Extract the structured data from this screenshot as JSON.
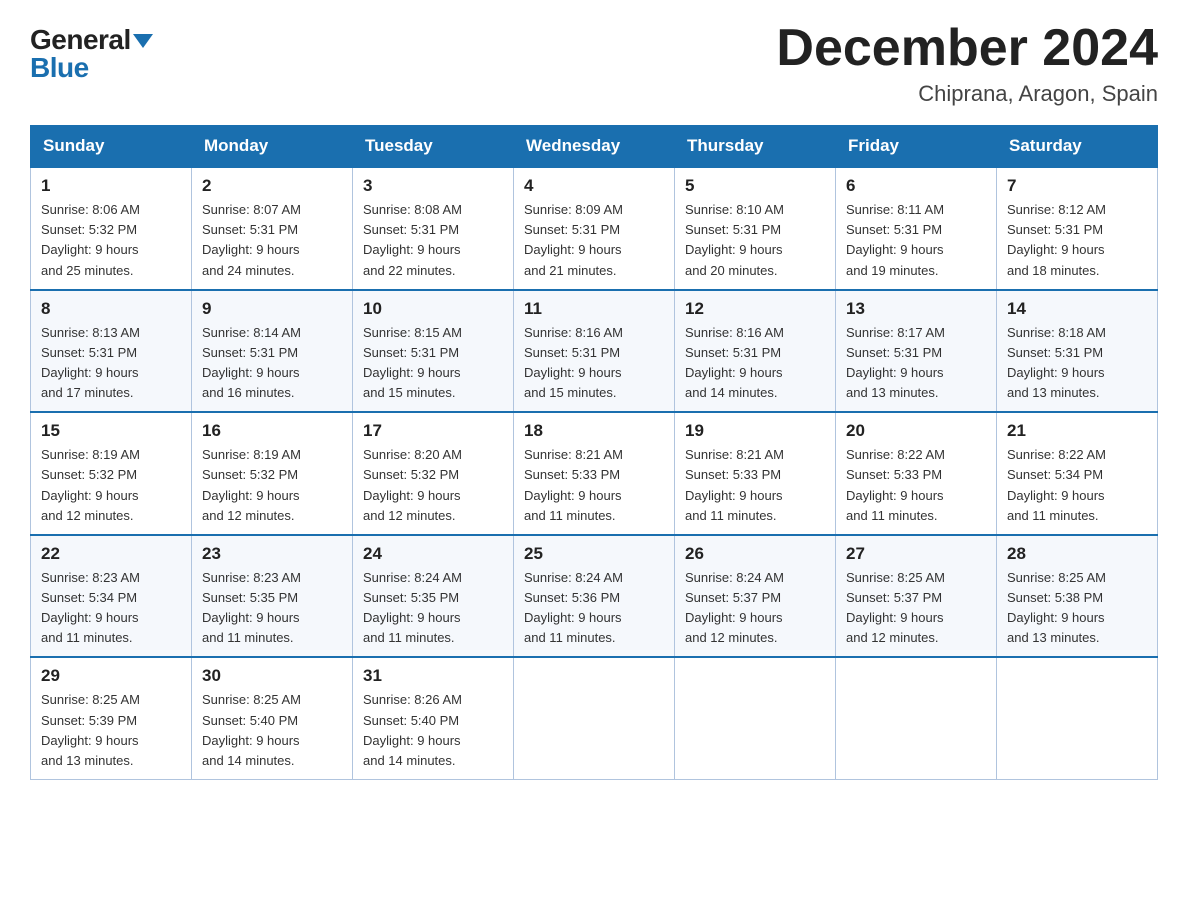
{
  "logo": {
    "general": "General",
    "blue": "Blue"
  },
  "header": {
    "month": "December 2024",
    "location": "Chiprana, Aragon, Spain"
  },
  "days_of_week": [
    "Sunday",
    "Monday",
    "Tuesday",
    "Wednesday",
    "Thursday",
    "Friday",
    "Saturday"
  ],
  "weeks": [
    [
      {
        "day": "1",
        "sunrise": "8:06 AM",
        "sunset": "5:32 PM",
        "daylight": "9 hours and 25 minutes."
      },
      {
        "day": "2",
        "sunrise": "8:07 AM",
        "sunset": "5:31 PM",
        "daylight": "9 hours and 24 minutes."
      },
      {
        "day": "3",
        "sunrise": "8:08 AM",
        "sunset": "5:31 PM",
        "daylight": "9 hours and 22 minutes."
      },
      {
        "day": "4",
        "sunrise": "8:09 AM",
        "sunset": "5:31 PM",
        "daylight": "9 hours and 21 minutes."
      },
      {
        "day": "5",
        "sunrise": "8:10 AM",
        "sunset": "5:31 PM",
        "daylight": "9 hours and 20 minutes."
      },
      {
        "day": "6",
        "sunrise": "8:11 AM",
        "sunset": "5:31 PM",
        "daylight": "9 hours and 19 minutes."
      },
      {
        "day": "7",
        "sunrise": "8:12 AM",
        "sunset": "5:31 PM",
        "daylight": "9 hours and 18 minutes."
      }
    ],
    [
      {
        "day": "8",
        "sunrise": "8:13 AM",
        "sunset": "5:31 PM",
        "daylight": "9 hours and 17 minutes."
      },
      {
        "day": "9",
        "sunrise": "8:14 AM",
        "sunset": "5:31 PM",
        "daylight": "9 hours and 16 minutes."
      },
      {
        "day": "10",
        "sunrise": "8:15 AM",
        "sunset": "5:31 PM",
        "daylight": "9 hours and 15 minutes."
      },
      {
        "day": "11",
        "sunrise": "8:16 AM",
        "sunset": "5:31 PM",
        "daylight": "9 hours and 15 minutes."
      },
      {
        "day": "12",
        "sunrise": "8:16 AM",
        "sunset": "5:31 PM",
        "daylight": "9 hours and 14 minutes."
      },
      {
        "day": "13",
        "sunrise": "8:17 AM",
        "sunset": "5:31 PM",
        "daylight": "9 hours and 13 minutes."
      },
      {
        "day": "14",
        "sunrise": "8:18 AM",
        "sunset": "5:31 PM",
        "daylight": "9 hours and 13 minutes."
      }
    ],
    [
      {
        "day": "15",
        "sunrise": "8:19 AM",
        "sunset": "5:32 PM",
        "daylight": "9 hours and 12 minutes."
      },
      {
        "day": "16",
        "sunrise": "8:19 AM",
        "sunset": "5:32 PM",
        "daylight": "9 hours and 12 minutes."
      },
      {
        "day": "17",
        "sunrise": "8:20 AM",
        "sunset": "5:32 PM",
        "daylight": "9 hours and 12 minutes."
      },
      {
        "day": "18",
        "sunrise": "8:21 AM",
        "sunset": "5:33 PM",
        "daylight": "9 hours and 11 minutes."
      },
      {
        "day": "19",
        "sunrise": "8:21 AM",
        "sunset": "5:33 PM",
        "daylight": "9 hours and 11 minutes."
      },
      {
        "day": "20",
        "sunrise": "8:22 AM",
        "sunset": "5:33 PM",
        "daylight": "9 hours and 11 minutes."
      },
      {
        "day": "21",
        "sunrise": "8:22 AM",
        "sunset": "5:34 PM",
        "daylight": "9 hours and 11 minutes."
      }
    ],
    [
      {
        "day": "22",
        "sunrise": "8:23 AM",
        "sunset": "5:34 PM",
        "daylight": "9 hours and 11 minutes."
      },
      {
        "day": "23",
        "sunrise": "8:23 AM",
        "sunset": "5:35 PM",
        "daylight": "9 hours and 11 minutes."
      },
      {
        "day": "24",
        "sunrise": "8:24 AM",
        "sunset": "5:35 PM",
        "daylight": "9 hours and 11 minutes."
      },
      {
        "day": "25",
        "sunrise": "8:24 AM",
        "sunset": "5:36 PM",
        "daylight": "9 hours and 11 minutes."
      },
      {
        "day": "26",
        "sunrise": "8:24 AM",
        "sunset": "5:37 PM",
        "daylight": "9 hours and 12 minutes."
      },
      {
        "day": "27",
        "sunrise": "8:25 AM",
        "sunset": "5:37 PM",
        "daylight": "9 hours and 12 minutes."
      },
      {
        "day": "28",
        "sunrise": "8:25 AM",
        "sunset": "5:38 PM",
        "daylight": "9 hours and 13 minutes."
      }
    ],
    [
      {
        "day": "29",
        "sunrise": "8:25 AM",
        "sunset": "5:39 PM",
        "daylight": "9 hours and 13 minutes."
      },
      {
        "day": "30",
        "sunrise": "8:25 AM",
        "sunset": "5:40 PM",
        "daylight": "9 hours and 14 minutes."
      },
      {
        "day": "31",
        "sunrise": "8:26 AM",
        "sunset": "5:40 PM",
        "daylight": "9 hours and 14 minutes."
      },
      null,
      null,
      null,
      null
    ]
  ],
  "labels": {
    "sunrise": "Sunrise:",
    "sunset": "Sunset:",
    "daylight": "Daylight:"
  }
}
